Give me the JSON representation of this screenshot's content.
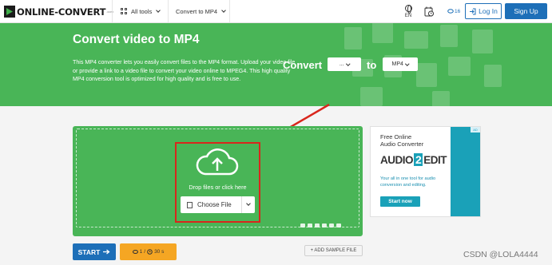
{
  "header": {
    "logo_text": "ONLINE-CONVERT",
    "logo_suffix": ".com",
    "nav_all_tools": "All tools",
    "nav_converter": "Convert to MP4",
    "language": "EN",
    "credits": "16",
    "login_label": "Log In",
    "signup_label": "Sign Up"
  },
  "hero": {
    "title": "Convert video to MP4",
    "description": "This MP4 converter lets you easily convert files to the MP4 format. Upload your video file or provide a link to a video file to convert your video online to MPEG4. This high quality MP4 conversion tool is optimized for high quality and is free to use.",
    "convert_label": "Convert",
    "from_value": "...",
    "to_label": "to",
    "to_value": "MP4"
  },
  "upload": {
    "drop_text": "Drop files or click here",
    "choose_label": "Choose File"
  },
  "actions": {
    "start_label": "START",
    "file_count": "1",
    "duration": "30 s",
    "sample_label": "+ ADD SAMPLE FILE"
  },
  "ad": {
    "badge": "AD",
    "line1": "Free Online",
    "line2": "Audio Converter",
    "brand_left": "AUDIO",
    "brand_mid": "2",
    "brand_right": "EDIT",
    "tagline": "Your all in one tool for audio conversion and editing.",
    "cta": "Start now"
  },
  "watermark": "CSDN @LOLA4444",
  "colors": {
    "green": "#49b557",
    "blue": "#1d6fb8",
    "orange": "#f5a623",
    "annotation_red": "#d9261c",
    "ad_teal": "#1aa1b8"
  }
}
